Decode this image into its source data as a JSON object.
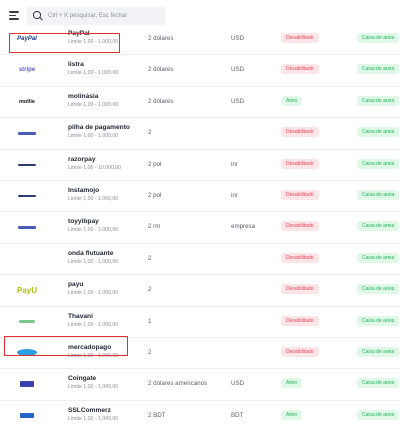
{
  "search": {
    "placeholder": "Ctrl + K pesquisar, Esc fechar"
  },
  "rows": [
    {
      "name": "PayPal",
      "limit": "Limite 1,00 - 1.000,00",
      "currency": "2 dólares",
      "code": "USD",
      "status": "Desabilitado",
      "status_type": "off",
      "sandbox": "Caixa de areia",
      "logo": "PayPal"
    },
    {
      "name": "listra",
      "limit": "Limite 1,00 - 1.000,00",
      "currency": "2 dólares",
      "code": "USD",
      "status": "Desabilitado",
      "status_type": "off",
      "sandbox": "Caixa de areia",
      "logo": "stripe"
    },
    {
      "name": "molinásia",
      "limit": "Limite 1,00 - 1.000,00",
      "currency": "2 dólares",
      "code": "USD",
      "status": "Ativo",
      "status_type": "on",
      "sandbox": "Caixa de areia",
      "logo": "mollie"
    },
    {
      "name": "pilha de pagamento",
      "limit": "Limite 1,00 - 1.000,00",
      "currency": "2",
      "code": "",
      "status": "Desabilitado",
      "status_type": "off",
      "sandbox": "Caixa de areia",
      "logo": ""
    },
    {
      "name": "razorpay",
      "limit": "Limite 1,00 - 10.000,00",
      "currency": "2 pol",
      "code": "inr",
      "status": "Desabilitado",
      "status_type": "off",
      "sandbox": "Caixa de areia",
      "logo": ""
    },
    {
      "name": "Instamojo",
      "limit": "Limite 1,00 - 1.000,00",
      "currency": "2 pol",
      "code": "inr",
      "status": "Desabilitado",
      "status_type": "off",
      "sandbox": "Caixa de areia",
      "logo": ""
    },
    {
      "name": "toyyibpay",
      "limit": "Limite 1,00 - 1.000,00",
      "currency": "2 rm",
      "code": "empresa",
      "status": "Desabilitado",
      "status_type": "off",
      "sandbox": "Caixa de areia",
      "logo": ""
    },
    {
      "name": "onda flutuante",
      "limit": "Limite 1,00 - 1.000,00",
      "currency": "2",
      "code": "",
      "status": "Desabilitado",
      "status_type": "off",
      "sandbox": "Caixa de areia",
      "logo": ""
    },
    {
      "name": "payu",
      "limit": "Limite 1,00 - 1.000,00",
      "currency": "2",
      "code": "",
      "status": "Desabilitado",
      "status_type": "off",
      "sandbox": "Caixa de areia",
      "logo": "PayU"
    },
    {
      "name": "Thavani",
      "limit": "Limite 1,00 - 1.000,00",
      "currency": "1",
      "code": "",
      "status": "Desabilitado",
      "status_type": "off",
      "sandbox": "Caixa de areia",
      "logo": ""
    },
    {
      "name": "mercadopago",
      "limit": "Limite 1,00 - 1.000,00",
      "currency": "2",
      "code": "",
      "status": "Desabilitado",
      "status_type": "off",
      "sandbox": "Caixa de areia",
      "logo": ""
    },
    {
      "name": "Coingate",
      "limit": "Limite 1,00 - 1.000,00",
      "currency": "2 dólares americanos",
      "code": "USD",
      "status": "Ativo",
      "status_type": "on",
      "sandbox": "Caixa de areia",
      "logo": ""
    },
    {
      "name": "SSLCommerz",
      "limit": "Limite 1,00 - 1.000,00",
      "currency": "2 BDT",
      "code": "BDT",
      "status": "Ativo",
      "status_type": "on",
      "sandbox": "Caixa de areia",
      "logo": ""
    }
  ],
  "colors": {
    "disabled_bg": "#fde4e6",
    "disabled_fg": "#e0475a",
    "active_bg": "#e0f8e8",
    "active_fg": "#25b25c",
    "highlight": "#e23030"
  }
}
